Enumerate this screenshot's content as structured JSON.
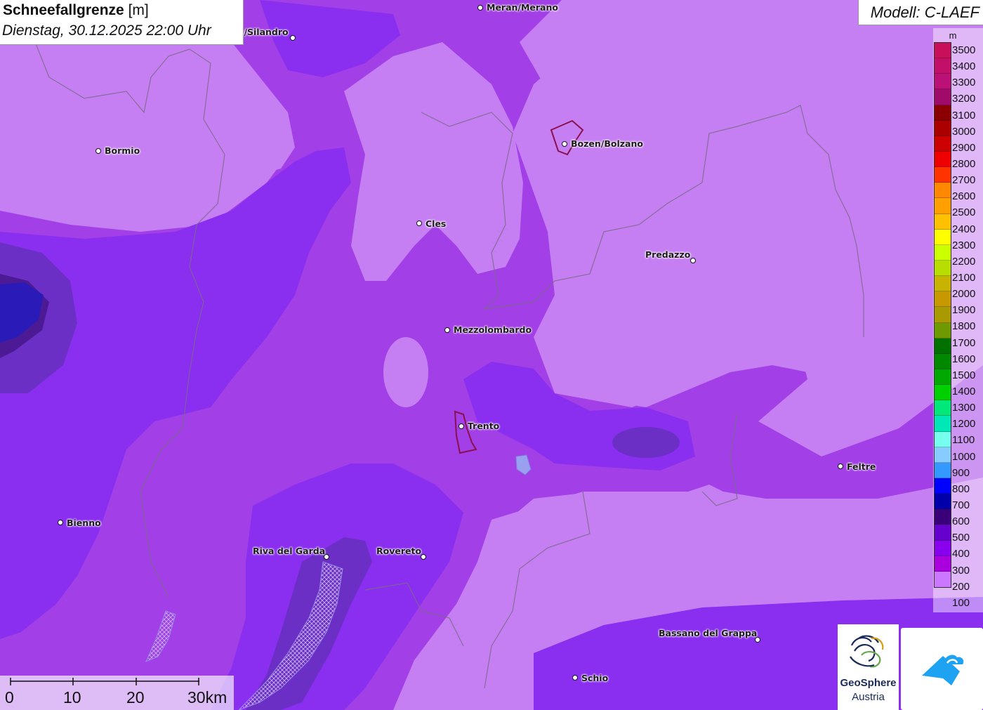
{
  "header": {
    "title": "Schneefallgrenze",
    "unit": "[m]",
    "subtitle": "Dienstag, 30.12.2025 22:00 Uhr"
  },
  "model": "Modell: C-LAEF",
  "legend": {
    "unit": "m",
    "items": [
      {
        "label": "3500",
        "color": "#c8105a"
      },
      {
        "label": "3400",
        "color": "#c21068"
      },
      {
        "label": "3300",
        "color": "#bb1075"
      },
      {
        "label": "3200",
        "color": "#a00a68"
      },
      {
        "label": "3100",
        "color": "#8a0000"
      },
      {
        "label": "3000",
        "color": "#aa0000"
      },
      {
        "label": "2900",
        "color": "#cc0000"
      },
      {
        "label": "2800",
        "color": "#ee0000"
      },
      {
        "label": "2700",
        "color": "#ff3300"
      },
      {
        "label": "2600",
        "color": "#ff8800"
      },
      {
        "label": "2500",
        "color": "#ffa000"
      },
      {
        "label": "2400",
        "color": "#ffc000"
      },
      {
        "label": "2300",
        "color": "#ffff00"
      },
      {
        "label": "2200",
        "color": "#ccff00"
      },
      {
        "label": "2100",
        "color": "#b8dd00"
      },
      {
        "label": "2000",
        "color": "#c8b400"
      },
      {
        "label": "1900",
        "color": "#c89800"
      },
      {
        "label": "1800",
        "color": "#a89a00"
      },
      {
        "label": "1700",
        "color": "#6f9900"
      },
      {
        "label": "1600",
        "color": "#007000"
      },
      {
        "label": "1500",
        "color": "#008800"
      },
      {
        "label": "1400",
        "color": "#00a800"
      },
      {
        "label": "1300",
        "color": "#00d000"
      },
      {
        "label": "1200",
        "color": "#00e87a"
      },
      {
        "label": "1100",
        "color": "#00e8b8"
      },
      {
        "label": "1000",
        "color": "#77ffee"
      },
      {
        "label": "900",
        "color": "#88ccff"
      },
      {
        "label": "800",
        "color": "#3399ff"
      },
      {
        "label": "700",
        "color": "#0000ff"
      },
      {
        "label": "600",
        "color": "#0000aa"
      },
      {
        "label": "500",
        "color": "#3a007a"
      },
      {
        "label": "400",
        "color": "#6600cc"
      },
      {
        "label": "300",
        "color": "#8800ee"
      },
      {
        "label": "200",
        "color": "#aa00dd"
      },
      {
        "label": "100",
        "color": "#cc77ff"
      }
    ]
  },
  "cities": [
    {
      "name": "Meran/Merano"
    },
    {
      "name": "s/Silandro"
    },
    {
      "name": "Bormio"
    },
    {
      "name": "Bozen/Bolzano"
    },
    {
      "name": "Cles"
    },
    {
      "name": "Predazzo"
    },
    {
      "name": "Mezzolombardo"
    },
    {
      "name": "Trento"
    },
    {
      "name": "Feltre"
    },
    {
      "name": "Bienno"
    },
    {
      "name": "Riva del Garda"
    },
    {
      "name": "Rovereto"
    },
    {
      "name": "Bassano del Grappa"
    },
    {
      "name": "Schio"
    }
  ],
  "scale": {
    "labels": [
      "0",
      "10",
      "20",
      "30km"
    ]
  },
  "logos": {
    "geo_name": "GeoSphere",
    "geo_sub": "Austria"
  }
}
